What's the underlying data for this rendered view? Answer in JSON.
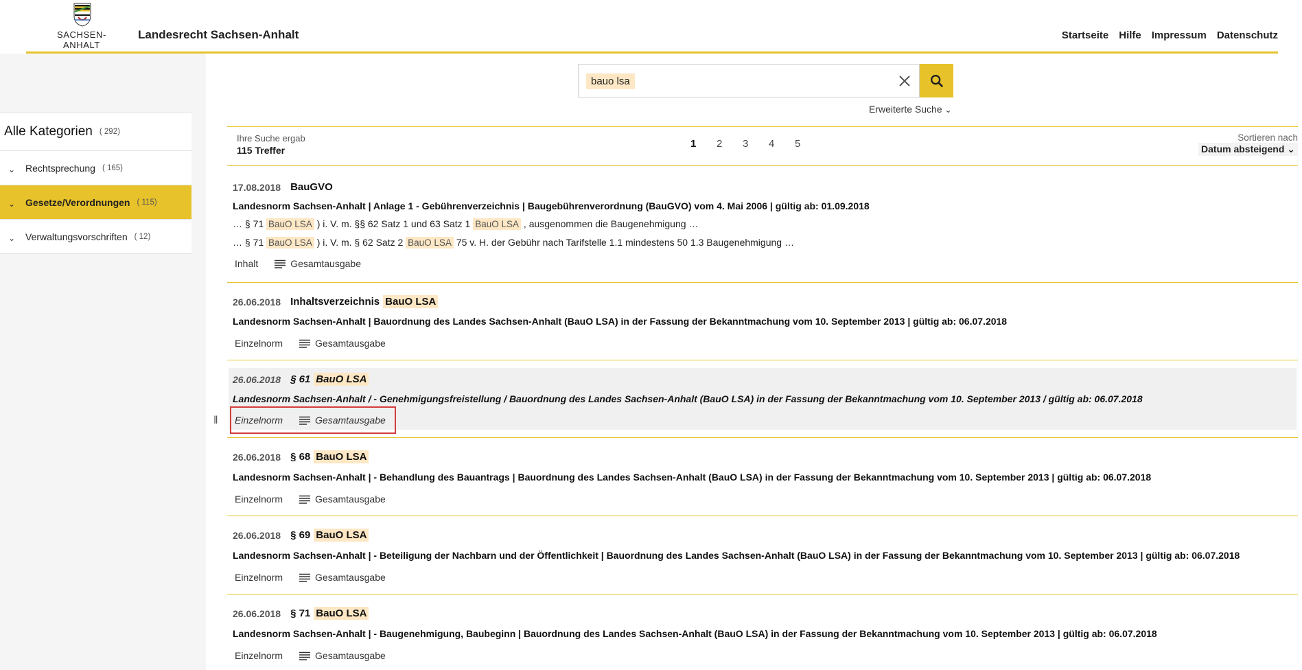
{
  "header": {
    "logo_text": "SACHSEN-ANHALT",
    "site_title": "Landesrecht Sachsen-Anhalt",
    "nav": [
      "Startseite",
      "Hilfe",
      "Impressum",
      "Datenschutz"
    ]
  },
  "sidebar": {
    "all_label": "Alle Kategorien",
    "all_count": "( 292)",
    "items": [
      {
        "label": "Rechtsprechung",
        "count": "( 165)",
        "active": false
      },
      {
        "label": "Gesetze/Verordnungen",
        "count": "( 115)",
        "active": true
      },
      {
        "label": "Verwaltungsvorschriften",
        "count": "( 12)",
        "active": false
      }
    ]
  },
  "search": {
    "query": "bauo lsa",
    "advanced_label": "Erweiterte Suche"
  },
  "results_header": {
    "label": "Ihre Suche ergab",
    "count": "115 Treffer",
    "pages": [
      "1",
      "2",
      "3",
      "4",
      "5"
    ],
    "current_page": "1",
    "sort_label": "Sortieren nach",
    "sort_value": "Datum absteigend"
  },
  "results": [
    {
      "date": "17.08.2018",
      "title": "BauGVO",
      "subtitle": "Landesnorm Sachsen-Anhalt | Anlage 1 - Gebührenverzeichnis | Baugebührenverordnung (BauGVO) vom 4. Mai 2006 | gültig ab: 01.09.2018",
      "snippet1": {
        "a": "… § 71",
        "b": "BauO LSA",
        "c": ") i. V. m. §§ 62 Satz 1 und 63 Satz 1",
        "d": "BauO LSA",
        "e": ", ausgenommen die Baugenehmigung …"
      },
      "snippet2": {
        "a": "… § 71",
        "b": "BauO LSA",
        "c": ") i. V. m. § 62 Satz 2",
        "d": "BauO LSA",
        "e": "75 v. H. der Gebühr nach Tarifstelle 1.1   mindestens 50 1.3 Baugenehmigung …"
      },
      "action1": "Inhalt",
      "action2": "Gesamtausgabe"
    },
    {
      "date": "26.06.2018",
      "title": "Inhaltsverzeichnis",
      "title_hl": "BauO LSA",
      "subtitle": "Landesnorm Sachsen-Anhalt | Bauordnung des Landes Sachsen-Anhalt (BauO LSA) in der Fassung der Bekanntmachung vom 10. September 2013 | gültig ab: 06.07.2018",
      "action1": "Einzelnorm",
      "action2": "Gesamtausgabe"
    },
    {
      "date": "26.06.2018",
      "title": "§ 61",
      "title_hl": "BauO LSA",
      "subtitle": "Landesnorm Sachsen-Anhalt / - Genehmigungsfreistellung / Bauordnung des Landes Sachsen-Anhalt (BauO LSA) in der Fassung der Bekanntmachung vom 10. September 2013 / gültig ab: 06.07.2018",
      "action1": "Einzelnorm",
      "action2": "Gesamtausgabe"
    },
    {
      "date": "26.06.2018",
      "title": "§ 68",
      "title_hl": "BauO LSA",
      "subtitle": "Landesnorm Sachsen-Anhalt | - Behandlung des Bauantrags | Bauordnung des Landes Sachsen-Anhalt (BauO LSA) in der Fassung der Bekanntmachung vom 10. September 2013 | gültig ab: 06.07.2018",
      "action1": "Einzelnorm",
      "action2": "Gesamtausgabe"
    },
    {
      "date": "26.06.2018",
      "title": "§ 69",
      "title_hl": "BauO LSA",
      "subtitle": "Landesnorm Sachsen-Anhalt | - Beteiligung der Nachbarn und der Öffentlichkeit | Bauordnung des Landes Sachsen-Anhalt (BauO LSA) in der Fassung der Bekanntmachung vom 10. September 2013 | gültig ab: 06.07.2018",
      "action1": "Einzelnorm",
      "action2": "Gesamtausgabe"
    },
    {
      "date": "26.06.2018",
      "title": "§ 71",
      "title_hl": "BauO LSA",
      "subtitle": "Landesnorm Sachsen-Anhalt | - Baugenehmigung, Baubeginn | Bauordnung des Landes Sachsen-Anhalt (BauO LSA) in der Fassung der Bekanntmachung vom 10. September 2013 | gültig ab: 06.07.2018",
      "action1": "Einzelnorm",
      "action2": "Gesamtausgabe"
    }
  ],
  "colors": {
    "accent": "#e8c22a",
    "highlight": "#fde7c4",
    "focus_border": "#d43d3d"
  },
  "icons": [
    "crest-icon",
    "clear-icon",
    "search-icon",
    "chevron-down-icon",
    "lines-icon",
    "splitter-handle-icon"
  ]
}
